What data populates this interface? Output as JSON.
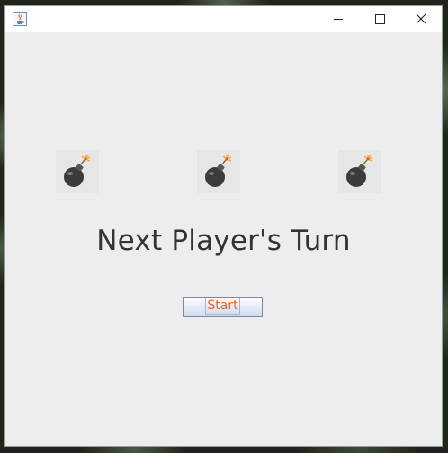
{
  "window": {
    "controls": {
      "minimize": "minimize-icon",
      "maximize": "maximize-icon",
      "close": "close-icon"
    },
    "app_icon": "java-cup-icon"
  },
  "main": {
    "bombs": [
      "bomb-icon",
      "bomb-icon",
      "bomb-icon"
    ],
    "message": "Next Player's Turn",
    "start_button_label": "Start"
  },
  "colors": {
    "window_bg": "#ededed",
    "title_text": "#333333",
    "button_text": "#e8632e",
    "bomb_body": "#3b3b3b",
    "fuse_spark": "#f5a623"
  }
}
